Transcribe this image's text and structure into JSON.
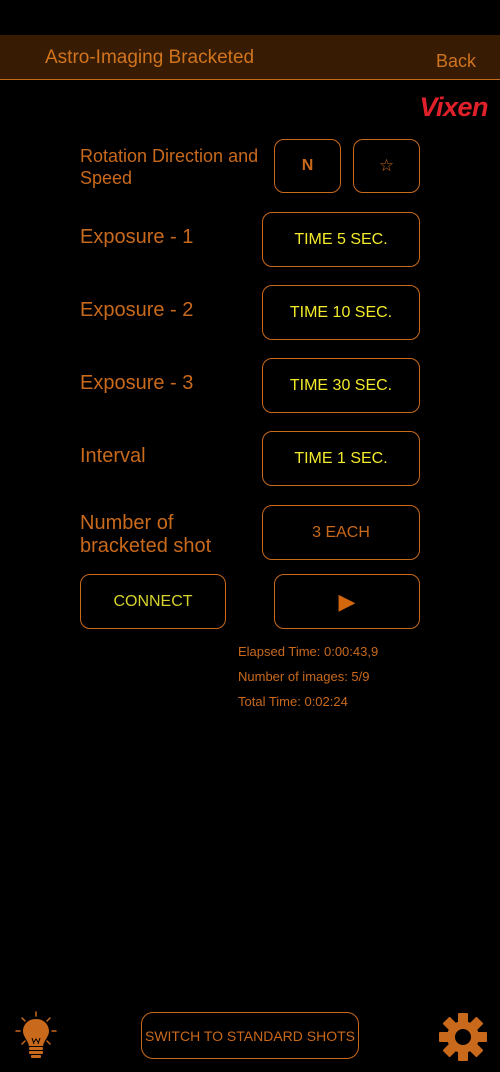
{
  "header": {
    "title": "Astro-Imaging Bracketed",
    "back_label": "Back"
  },
  "brand": {
    "logo_text": "Vixen",
    "logo_color": "#e0202a"
  },
  "settings": {
    "rotation": {
      "label": "Rotation Direction and Speed",
      "direction_value": "N",
      "speed_icon": "star-icon",
      "speed_glyph": "☆"
    },
    "exposure1": {
      "label": "Exposure - 1",
      "value": "TIME 5 SEC."
    },
    "exposure2": {
      "label": "Exposure - 2",
      "value": "TIME 10 SEC."
    },
    "exposure3": {
      "label": "Exposure - 3",
      "value": "TIME 30 SEC."
    },
    "interval": {
      "label": "Interval",
      "value": "TIME 1 SEC."
    },
    "bracketed": {
      "label": "Number of bracketed shot",
      "value": "3 EACH"
    }
  },
  "actions": {
    "connect_label": "CONNECT",
    "play_glyph": "▶"
  },
  "status": {
    "elapsed": "Elapsed Time:  0:00:43,9",
    "images": "Number of images:  5/9",
    "total": "Total Time: 0:02:24"
  },
  "footer": {
    "switch_label": "SWITCH TO STANDARD SHOTS",
    "left_icon": "lightbulb-icon",
    "right_icon": "gear-icon"
  },
  "colors": {
    "accent": "#c8691c",
    "value_text": "#f2ea2a",
    "header_bg": "#371b03"
  }
}
